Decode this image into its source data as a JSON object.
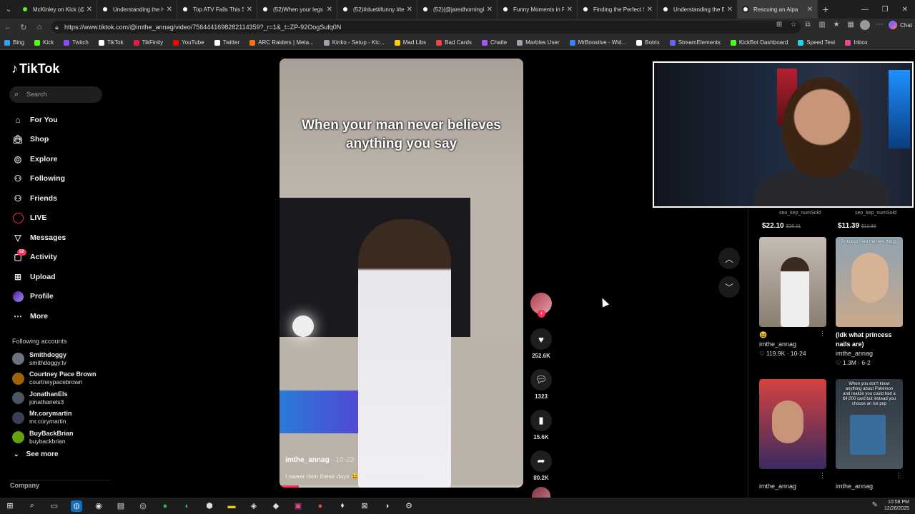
{
  "browser": {
    "tabs": [
      {
        "label": "McKinley on Kick (@m",
        "color": "#53fc18"
      },
      {
        "label": "Understanding the Hu",
        "color": "#ffffff"
      },
      {
        "label": "Top ATV Fails This Sea",
        "color": "#ffffff"
      },
      {
        "label": "(52)When your legs do",
        "color": "#ffffff"
      },
      {
        "label": "(52)#duet#funny #tere",
        "color": "#ffffff"
      },
      {
        "label": "(52)(@jaredhorning87",
        "color": "#ffffff"
      },
      {
        "label": "Funny Moments in Rel",
        "color": "#ffffff"
      },
      {
        "label": "Finding the Perfect Sp",
        "color": "#ffffff"
      },
      {
        "label": "Understanding the Bik",
        "color": "#ffffff"
      },
      {
        "label": "Rescuing an Alpa",
        "color": "#ffffff",
        "active": true
      }
    ],
    "url": "https://www.tiktok.com/@imthe_annag/video/7564441698282114359?_r=1&_t=ZP-92OogSufq0N",
    "chat_label": "Chat",
    "bookmarks": [
      {
        "label": "Bing",
        "color": "#2ea5f0"
      },
      {
        "label": "Kick",
        "color": "#53fc18"
      },
      {
        "label": "Twitch",
        "color": "#9146ff"
      },
      {
        "label": "TikTok",
        "color": "#ffffff"
      },
      {
        "label": "TikFinity",
        "color": "#e11d48"
      },
      {
        "label": "YouTube",
        "color": "#ff0000"
      },
      {
        "label": "Twitter",
        "color": "#ffffff"
      },
      {
        "label": "ARC Raiders | Meta...",
        "color": "#f97316"
      },
      {
        "label": "Kinko - Setup - Kic...",
        "color": "#9ca3af"
      },
      {
        "label": "Mad Libs",
        "color": "#facc15"
      },
      {
        "label": "Bad Cards",
        "color": "#ef4444"
      },
      {
        "label": "Chatle",
        "color": "#a855f7"
      },
      {
        "label": "Marbles User",
        "color": "#9ca3af"
      },
      {
        "label": "MrBoostive - Wid...",
        "color": "#3b82f6"
      },
      {
        "label": "Botrix",
        "color": "#ffffff"
      },
      {
        "label": "StreamElements",
        "color": "#6366f1"
      },
      {
        "label": "KickBot Dashboard",
        "color": "#53fc18"
      },
      {
        "label": "Speed Test",
        "color": "#22d3ee"
      },
      {
        "label": "Inbox",
        "color": "#ec4899"
      }
    ]
  },
  "sidebar": {
    "logo": "TikTok",
    "search_placeholder": "Search",
    "nav": [
      {
        "label": "For You",
        "icon": "home-icon"
      },
      {
        "label": "Shop",
        "icon": "bag-icon"
      },
      {
        "label": "Explore",
        "icon": "compass-icon"
      },
      {
        "label": "Following",
        "icon": "following-icon"
      },
      {
        "label": "Friends",
        "icon": "friends-icon"
      },
      {
        "label": "LIVE",
        "icon": "live-icon"
      },
      {
        "label": "Messages",
        "icon": "send-icon"
      },
      {
        "label": "Activity",
        "icon": "inbox-icon",
        "badge": "52"
      },
      {
        "label": "Upload",
        "icon": "plus-square-icon"
      },
      {
        "label": "Profile",
        "icon": "avatar-icon"
      },
      {
        "label": "More",
        "icon": "more-icon"
      }
    ],
    "following_title": "Following accounts",
    "following": [
      {
        "name": "Smithdoggy",
        "handle": "smithdoggy.tv"
      },
      {
        "name": "Courtney Pace Brown",
        "handle": "courtneypacebrown"
      },
      {
        "name": "JonathanEls",
        "handle": "jonathanels3"
      },
      {
        "name": "Mr.corymartin",
        "handle": "mr.corymartin"
      },
      {
        "name": "BuyBackBrian",
        "handle": "buybackbrian"
      }
    ],
    "see_more": "See more",
    "company": "Company"
  },
  "video": {
    "caption": "When your man never believes anything you say",
    "author": "imthe_annag",
    "date": "· 10-23",
    "description": "I swear men these days 😆 @Nature Health Farms ...",
    "progress": 0.08,
    "likes": "252.6K",
    "comments": "1323",
    "saves": "15.6K",
    "shares": "80.2K"
  },
  "right": {
    "top_items": [
      {
        "seo": "seo_kep_numSold",
        "price": "$22.10",
        "old": "$28.11"
      },
      {
        "seo": "seo_kep_numSold",
        "price": "$11.39",
        "old": "$11.99"
      }
    ],
    "videos": [
      {
        "title": "😆",
        "author": "imthe_annag",
        "stats": "♡ 119.9K · 10-24",
        "caption": ""
      },
      {
        "title": "(Idk what princess nails are)",
        "author": "imthe_annag",
        "stats": "♡ 1.3M · 6-2",
        "caption": "Princess? Are the new things"
      },
      {
        "title": "",
        "author": "imthe_annag",
        "stats": "",
        "caption": ""
      },
      {
        "title": "",
        "author": "imthe_annag",
        "stats": "",
        "caption": "When you don't know anything about Pokémon and realize you could had a $4,000 card but instead you choose an ice pop"
      }
    ]
  },
  "taskbar": {
    "time": "10:58 PM",
    "date": "12/26/2025"
  }
}
